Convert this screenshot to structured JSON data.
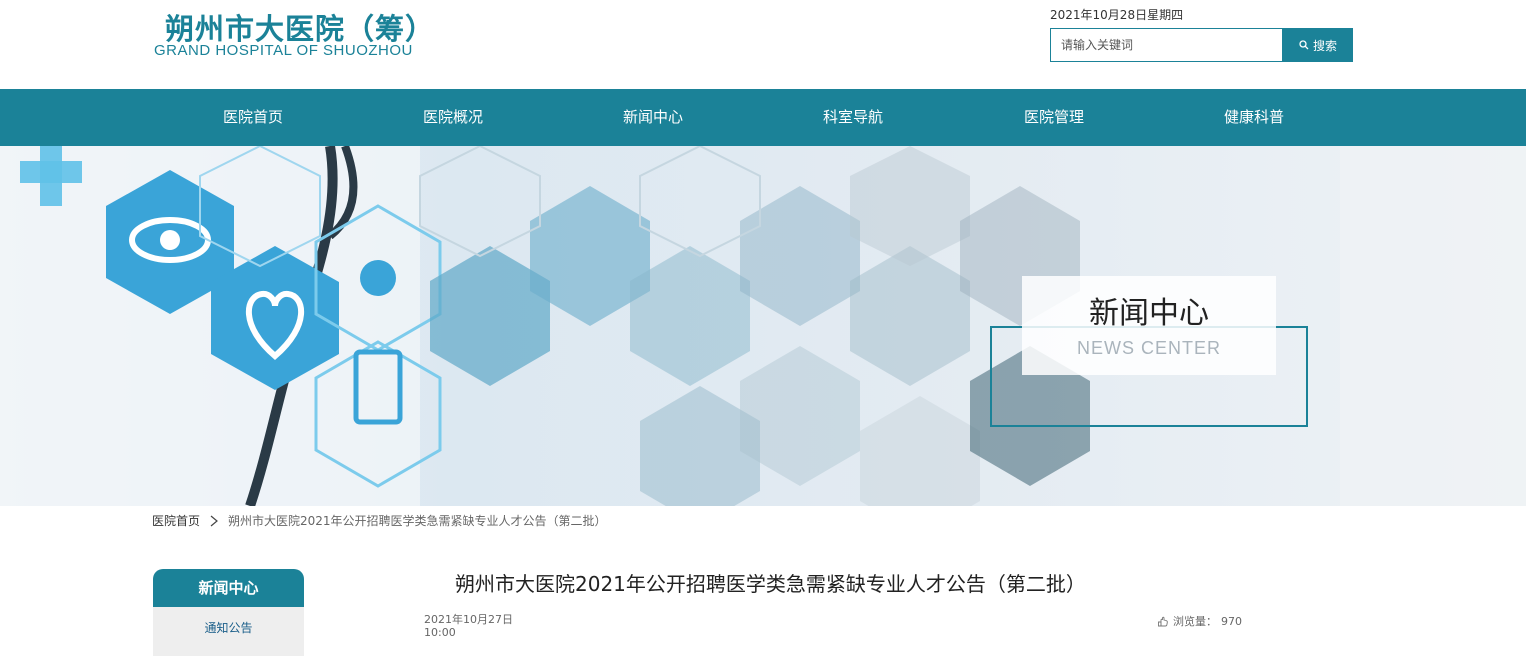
{
  "header": {
    "logo_cn": "朔州市大医院（筹）",
    "logo_en": "GRAND HOSPITAL OF SHUOZHOU",
    "date": "2021年10月28日星期四",
    "search_placeholder": "请输入关键词",
    "search_button": "搜索"
  },
  "nav": {
    "items": [
      {
        "label": "医院首页"
      },
      {
        "label": "医院概况"
      },
      {
        "label": "新闻中心"
      },
      {
        "label": "科室导航"
      },
      {
        "label": "医院管理"
      },
      {
        "label": "健康科普"
      }
    ]
  },
  "banner": {
    "title": "新闻中心",
    "subtitle": "NEWS CENTER"
  },
  "breadcrumb": {
    "home": "医院首页",
    "current": "朔州市大医院2021年公开招聘医学类急需紧缺专业人才公告（第二批）"
  },
  "sidebar": {
    "heading": "新闻中心",
    "items": [
      {
        "label": "通知公告"
      }
    ]
  },
  "article": {
    "title": "朔州市大医院2021年公开招聘医学类急需紧缺专业人才公告（第二批）",
    "date": "2021年10月27日",
    "time": "10:00",
    "views_label": "浏览量：",
    "views_count": "970"
  },
  "colors": {
    "primary": "#1b8298",
    "sidebar_bg": "#eeeeee"
  }
}
